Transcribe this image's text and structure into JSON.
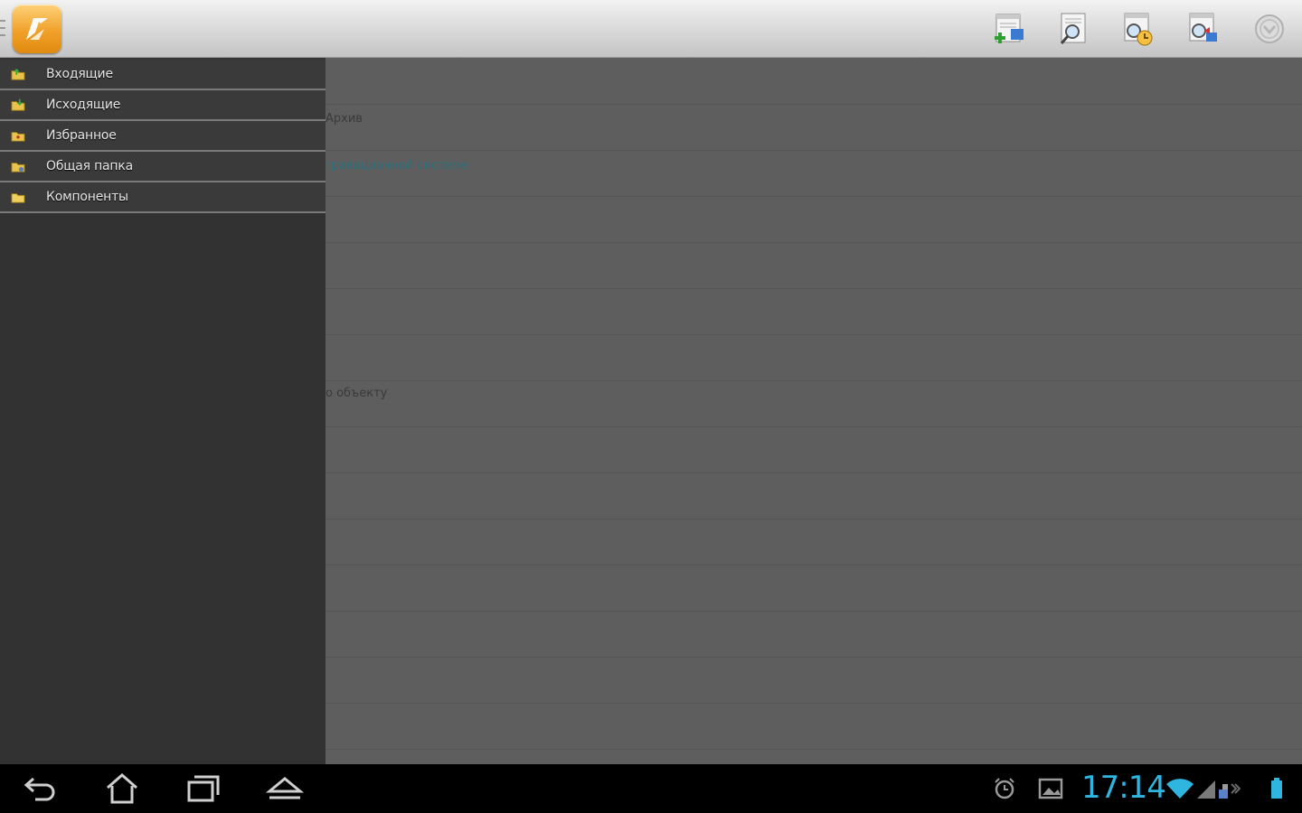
{
  "sidebar": {
    "items": [
      {
        "label": "Входящие",
        "icon": "inbox-folder-icon"
      },
      {
        "label": "Исходящие",
        "icon": "outbox-folder-icon"
      },
      {
        "label": "Избранное",
        "icon": "favorites-folder-icon"
      },
      {
        "label": "Общая папка",
        "icon": "shared-folder-icon"
      },
      {
        "label": "Компоненты",
        "icon": "components-folder-icon"
      }
    ]
  },
  "content": {
    "fragments": [
      {
        "text": "Архив"
      },
      {
        "text": "гравационной системе"
      },
      {
        "text": "о объекту"
      }
    ]
  },
  "status": {
    "clock": "17:14"
  },
  "colors": {
    "accent": "#2fb6e0",
    "logo": "#f0a12a",
    "sidebar_bg": "#323232",
    "content_dim": "#5e5e5e"
  },
  "icons": {
    "toolbar": [
      "create-document-icon",
      "search-document-icon",
      "document-history-icon",
      "document-sync-icon",
      "overflow-menu-icon"
    ],
    "nav": [
      "back-icon",
      "home-icon",
      "recent-apps-icon",
      "menu-up-icon"
    ],
    "status": [
      "alarm-icon",
      "gallery-icon",
      "wifi-icon",
      "signal-icon",
      "battery-icon"
    ]
  }
}
